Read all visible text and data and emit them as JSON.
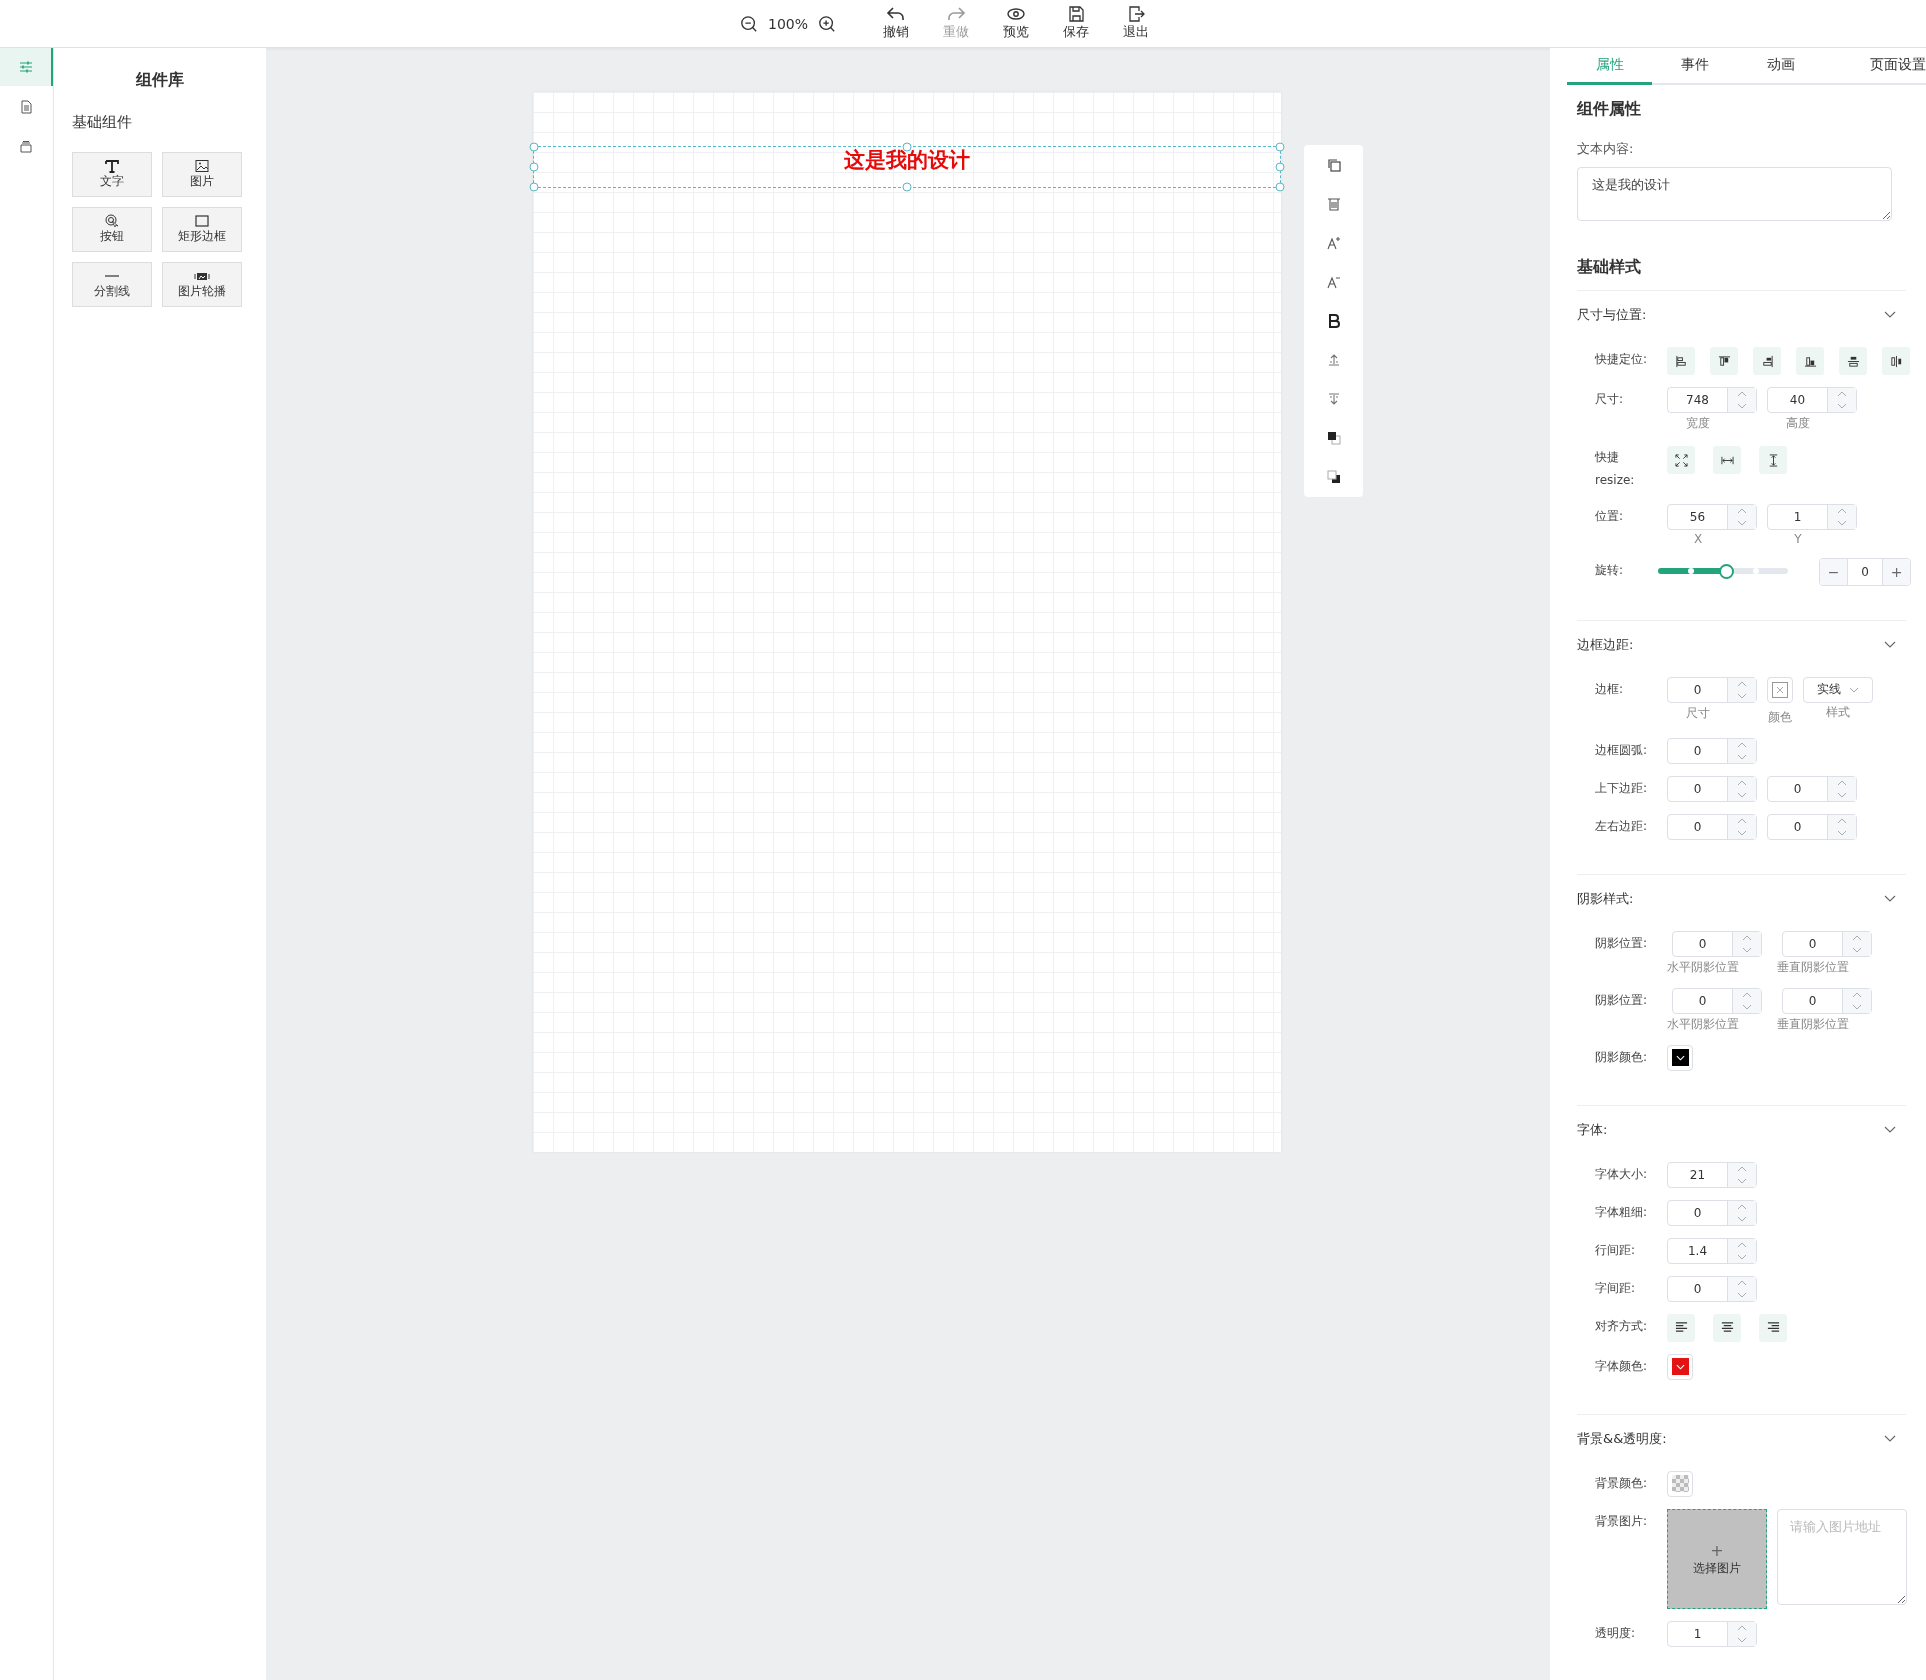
{
  "toolbar": {
    "zoom": "100%",
    "actions": [
      {
        "label": "撤销",
        "disabled": false
      },
      {
        "label": "重做",
        "disabled": true
      },
      {
        "label": "预览",
        "disabled": false
      },
      {
        "label": "保存",
        "disabled": false
      },
      {
        "label": "退出",
        "disabled": false
      }
    ]
  },
  "rail": {
    "items": [
      {
        "selected": true
      },
      {
        "selected": false
      },
      {
        "selected": false
      }
    ]
  },
  "library": {
    "title": "组件库",
    "group": "基础组件",
    "components": [
      {
        "label": "文字"
      },
      {
        "label": "图片"
      },
      {
        "label": "按钮"
      },
      {
        "label": "矩形边框"
      },
      {
        "label": "分割线"
      },
      {
        "label": "图片轮播"
      }
    ]
  },
  "canvas": {
    "element": {
      "text": "这是我的设计",
      "selected": true
    }
  },
  "panel": {
    "tabs": [
      {
        "label": "属性",
        "selected": true
      },
      {
        "label": "事件",
        "selected": false
      },
      {
        "label": "动画",
        "selected": false
      },
      {
        "label": "页面设置",
        "selected": false
      }
    ],
    "heading": "组件属性",
    "text_label": "文本内容:",
    "text_value": "这是我的设计",
    "style_heading": "基础样式",
    "sections": [
      {
        "title": "尺寸与位置:",
        "expanded": true,
        "rows": [
          {
            "kind": "position",
            "label": "快捷定位:"
          },
          {
            "kind": "numbers",
            "label": "尺寸:",
            "fields": [
              {
                "value": "748",
                "caption": "宽度"
              },
              {
                "value": "40",
                "caption": "高度"
              }
            ]
          },
          {
            "kind": "resize",
            "label": "快捷 resize:"
          },
          {
            "kind": "numbers",
            "label": "位置:",
            "fields": [
              {
                "value": "56",
                "caption": "X"
              },
              {
                "value": "1",
                "caption": "Y"
              }
            ]
          },
          {
            "kind": "slider",
            "label": "旋转:",
            "level": 0.5,
            "value": "0",
            "minus": "−",
            "plus": "+"
          }
        ]
      },
      {
        "title": "边框边距:",
        "expanded": true,
        "rows": [
          {
            "kind": "border",
            "label": "边框:",
            "fields": [
              {
                "value": "0",
                "caption": "尺寸"
              }
            ],
            "color_caption": "颜色",
            "style_value": "实线",
            "style_caption": "样式"
          },
          {
            "kind": "numbers",
            "label": "边框圆弧:",
            "fields": [
              {
                "value": "0"
              }
            ]
          },
          {
            "kind": "numbers",
            "label": "上下边距:",
            "fields": [
              {
                "value": "0"
              },
              {
                "value": "0"
              }
            ]
          },
          {
            "kind": "numbers",
            "label": "左右边距:",
            "fields": [
              {
                "value": "0"
              },
              {
                "value": "0"
              }
            ]
          }
        ]
      },
      {
        "title": "阴影样式:",
        "expanded": true,
        "rows": [
          {
            "kind": "numbers",
            "label": "阴影位置:",
            "fields": [
              {
                "value": "0",
                "caption": "水平阴影位置"
              },
              {
                "value": "0",
                "caption": "垂直阴影位置"
              }
            ]
          },
          {
            "kind": "numbers",
            "label": "阴影位置:",
            "fields": [
              {
                "value": "0",
                "caption": "水平阴影位置"
              },
              {
                "value": "0",
                "caption": "垂直阴影位置"
              }
            ]
          },
          {
            "kind": "color",
            "label": "阴影颜色:",
            "color": "#000000"
          }
        ]
      },
      {
        "title": "字体:",
        "expanded": true,
        "rows": [
          {
            "kind": "numbers",
            "label": "字体大小:",
            "fields": [
              {
                "value": "21"
              }
            ]
          },
          {
            "kind": "numbers",
            "label": "字体粗细:",
            "fields": [
              {
                "value": "0"
              }
            ]
          },
          {
            "kind": "numbers",
            "label": "行间距:",
            "fields": [
              {
                "value": "1.4"
              }
            ]
          },
          {
            "kind": "numbers",
            "label": "字间距:",
            "fields": [
              {
                "value": "0"
              }
            ]
          },
          {
            "kind": "align",
            "label": "对齐方式:"
          },
          {
            "kind": "color",
            "label": "字体颜色:",
            "color": "#e51414"
          }
        ]
      },
      {
        "title": "背景&&透明度:",
        "expanded": true,
        "rows": [
          {
            "kind": "transparent",
            "label": "背景颜色:"
          },
          {
            "kind": "image",
            "label": "背景图片:",
            "plus": "+",
            "button": "选择图片",
            "placeholder": "请输入图片地址"
          },
          {
            "kind": "numbers",
            "label": "透明度:",
            "fields": [
              {
                "value": "1"
              }
            ]
          }
        ]
      }
    ]
  }
}
